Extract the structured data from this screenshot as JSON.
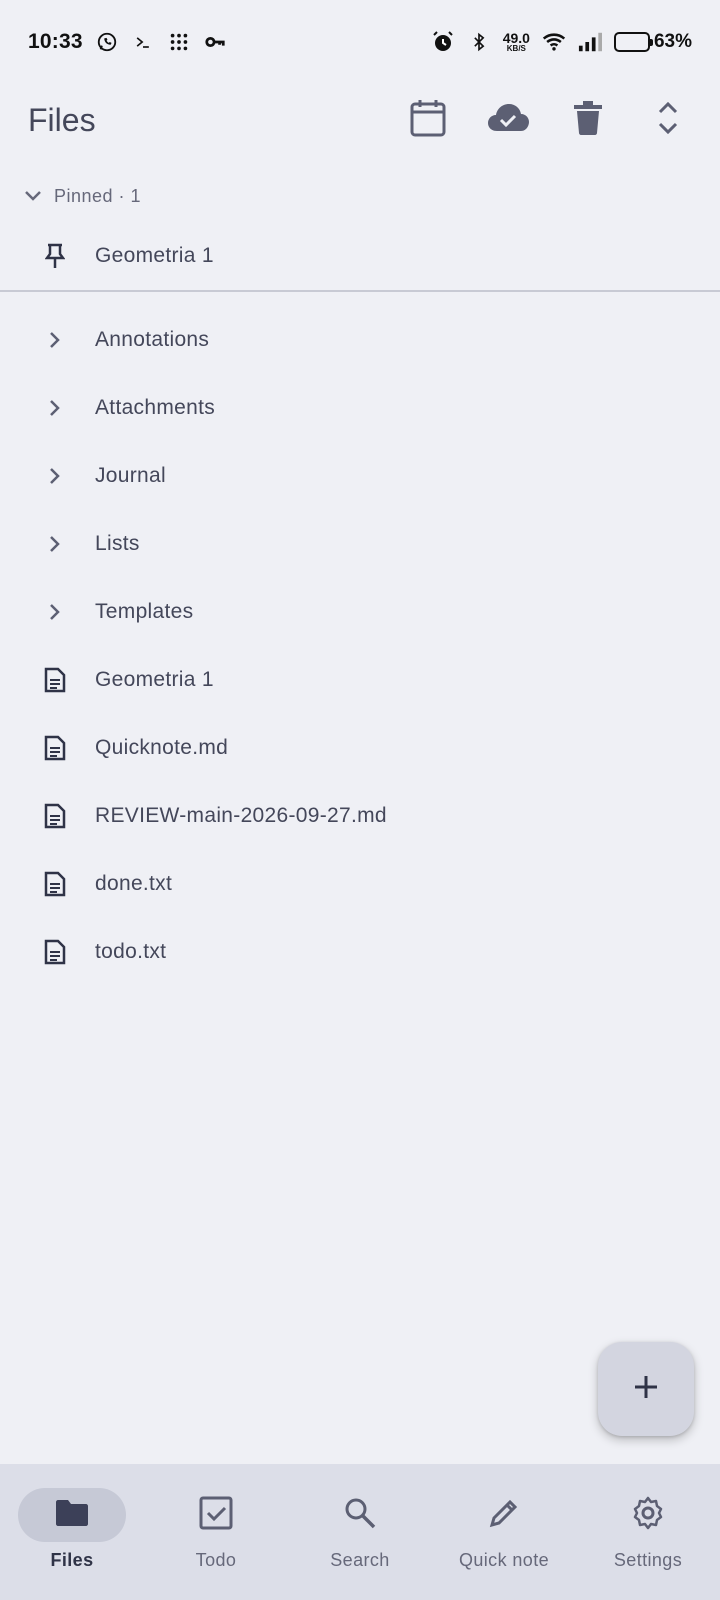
{
  "status_bar": {
    "time": "10:33",
    "net_speed_value": "49.0",
    "net_speed_unit": "KB/S",
    "battery": "63%",
    "battery_level": 0.63,
    "icons_left": [
      "whatsapp-icon",
      "terminal-icon",
      "dots-grid-icon",
      "key-icon"
    ],
    "icons_right": [
      "alarm-icon",
      "bluetooth-icon",
      "wifi-icon",
      "signal-icon",
      "battery-icon"
    ]
  },
  "appbar": {
    "title": "Files",
    "actions": [
      "calendar-icon",
      "cloud-done-icon",
      "trash-icon",
      "expand-collapse-icon"
    ]
  },
  "pinned": {
    "header": "Pinned · 1",
    "items": [
      {
        "label": "Geometria 1",
        "icon": "pin-icon"
      }
    ]
  },
  "folders": [
    {
      "label": "Annotations"
    },
    {
      "label": "Attachments"
    },
    {
      "label": "Journal"
    },
    {
      "label": "Lists"
    },
    {
      "label": "Templates"
    }
  ],
  "files": [
    {
      "label": "Geometria 1"
    },
    {
      "label": "Quicknote.md"
    },
    {
      "label": "REVIEW-main-2026-09-27.md"
    },
    {
      "label": "done.txt"
    },
    {
      "label": "todo.txt"
    }
  ],
  "bottom_nav": [
    {
      "label": "Files",
      "icon": "folder-icon",
      "active": true
    },
    {
      "label": "Todo",
      "icon": "checkbox-icon",
      "active": false
    },
    {
      "label": "Search",
      "icon": "search-icon",
      "active": false
    },
    {
      "label": "Quick note",
      "icon": "pencil-icon",
      "active": false
    },
    {
      "label": "Settings",
      "icon": "gear-icon",
      "active": false
    }
  ],
  "colors": {
    "background": "#eff0f5",
    "text": "#44475a",
    "nav_bg": "#dcdee8",
    "fab_bg": "#d3d5e0"
  }
}
